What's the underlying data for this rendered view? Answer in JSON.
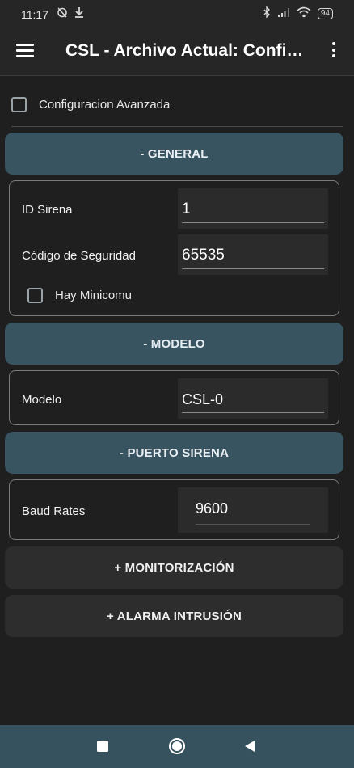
{
  "status_bar": {
    "time": "11:17",
    "battery": "94",
    "left_icons": [
      "alarm-off-icon",
      "download-icon"
    ],
    "right_icons": [
      "bluetooth-icon",
      "signal-icon",
      "wifi-icon",
      "battery-icon"
    ]
  },
  "app_bar": {
    "title": "CSL - Archivo Actual: Configuracion"
  },
  "advanced": {
    "label": "Configuracion Avanzada",
    "checked": false
  },
  "sections": {
    "general": {
      "label": "- GENERAL",
      "fields": {
        "id_sirena": {
          "label": "ID Sirena",
          "value": "1"
        },
        "codigo_seguridad": {
          "label": "Código de Seguridad",
          "value": "65535"
        }
      },
      "minicomu": {
        "label": "Hay Minicomu",
        "checked": false
      }
    },
    "modelo": {
      "label": "- MODELO",
      "fields": {
        "modelo": {
          "label": "Modelo",
          "value": "CSL-0"
        }
      }
    },
    "puerto_sirena": {
      "label": "- PUERTO SIRENA",
      "fields": {
        "baud_rates": {
          "label": "Baud Rates",
          "value": "9600"
        }
      }
    },
    "monitorizacion": {
      "label": "+ MONITORIZACIÓN"
    },
    "alarma_intrusion": {
      "label": "+ ALARMA INTRUSIÓN"
    }
  },
  "nav_bar": {
    "buttons": [
      "recents-square-icon",
      "home-circle-icon",
      "back-triangle-icon"
    ]
  },
  "colors": {
    "background": "#1f1f1f",
    "bar": "#262626",
    "section_open": "#395461",
    "section_closed": "#2d2d2d",
    "nav_bar": "#36525f"
  }
}
